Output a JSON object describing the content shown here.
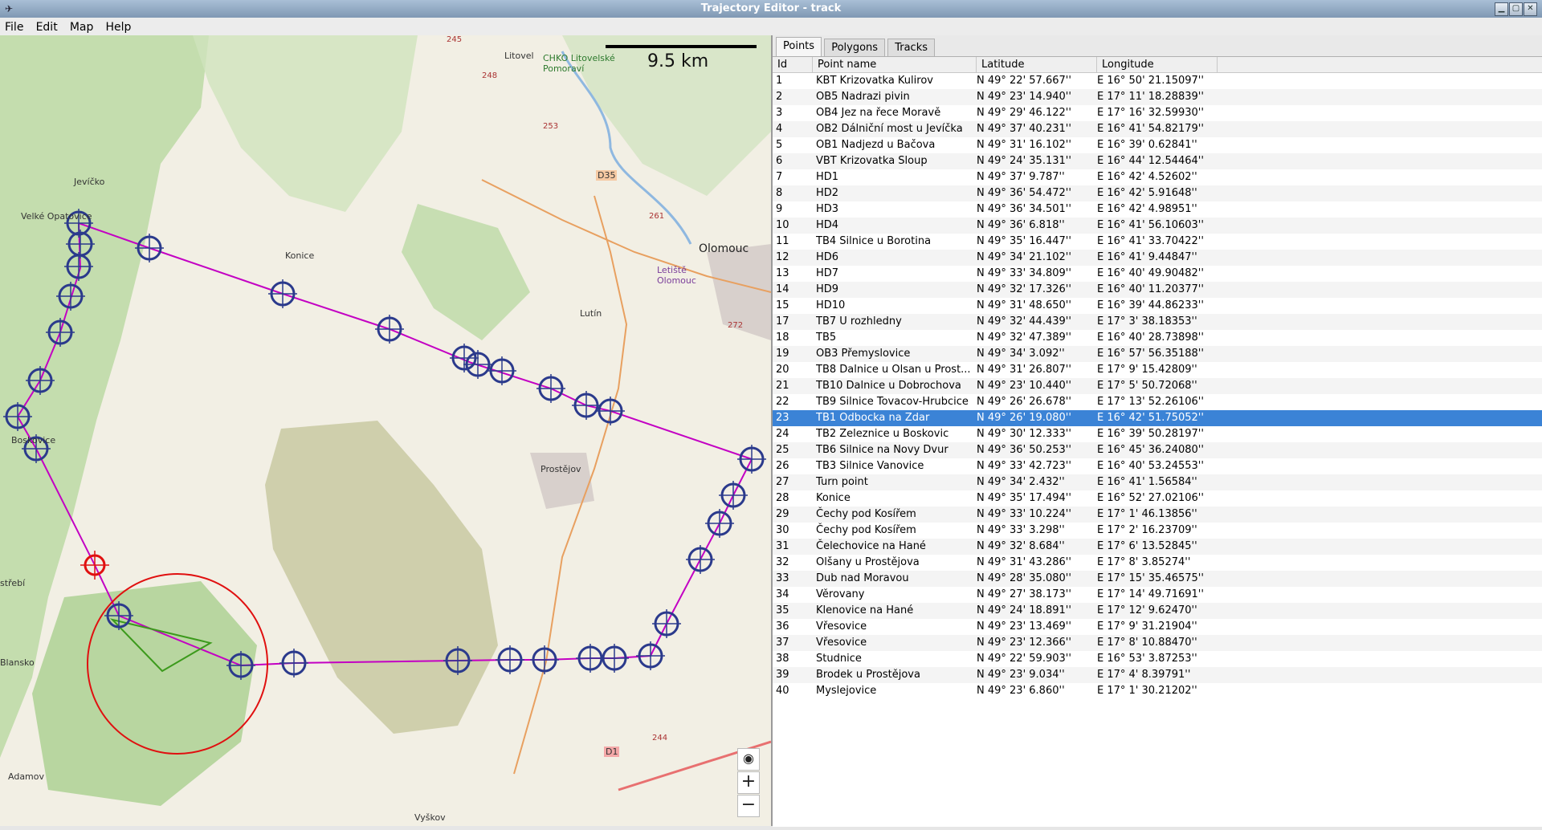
{
  "window": {
    "title": "Trajectory Editor - track"
  },
  "menu": [
    "File",
    "Edit",
    "Map",
    "Help"
  ],
  "map": {
    "scale_label": "9.5 km",
    "labels": {
      "jevicko": "Jevíčko",
      "velke_opatovice": "Velké Opatovice",
      "konice": "Konice",
      "litovel": "Litovel",
      "chko": "CHKO Litovelské Pomoraví",
      "olomouc": "Olomouc",
      "letiste": "Letiště Olomouc",
      "lutin": "Lutín",
      "boskovice": "Boskovice",
      "prostejov": "Prostějov",
      "blansko": "Blansko",
      "adamov": "Adamov",
      "vyskov": "Vyškov",
      "strebi": "střebí",
      "road_d35": "D35",
      "road_d1": "D1",
      "road_245": "245",
      "road_248": "248",
      "road_253": "253",
      "road_261": "261",
      "road_272": "272",
      "road_244": "244"
    },
    "controls": {
      "locate": "◉",
      "zoom_in": "+",
      "zoom_out": "−"
    }
  },
  "tabs": [
    "Points",
    "Polygons",
    "Tracks"
  ],
  "active_tab": "Points",
  "columns": [
    "Id",
    "Point name",
    "Latitude",
    "Longitude"
  ],
  "rows": [
    {
      "id": "1",
      "name": "KBT Krizovatka Kulirov",
      "lat": "N 49° 22' 57.667''",
      "lon": "E 16° 50' 21.15097''"
    },
    {
      "id": "2",
      "name": "OB5 Nadrazi pivin",
      "lat": "N 49° 23' 14.940''",
      "lon": "E 17° 11' 18.28839''"
    },
    {
      "id": "3",
      "name": "OB4 Jez na řece Moravě",
      "lat": "N 49° 29' 46.122''",
      "lon": "E 17° 16' 32.59930''"
    },
    {
      "id": "4",
      "name": "OB2 Dálniční most u Jevíčka",
      "lat": "N 49° 37' 40.231''",
      "lon": "E 16° 41' 54.82179''"
    },
    {
      "id": "5",
      "name": "OB1 Nadjezd u Bačova",
      "lat": "N 49° 31' 16.102''",
      "lon": "E 16° 39' 0.62841''"
    },
    {
      "id": "6",
      "name": "VBT Krizovatka Sloup",
      "lat": "N 49° 24' 35.131''",
      "lon": "E 16° 44' 12.54464''"
    },
    {
      "id": "7",
      "name": "HD1",
      "lat": "N 49° 37' 9.787''",
      "lon": "E 16° 42' 4.52602''"
    },
    {
      "id": "8",
      "name": "HD2",
      "lat": "N 49° 36' 54.472''",
      "lon": "E 16° 42' 5.91648''"
    },
    {
      "id": "9",
      "name": "HD3",
      "lat": "N 49° 36' 34.501''",
      "lon": "E 16° 42' 4.98951''"
    },
    {
      "id": "10",
      "name": "HD4",
      "lat": "N 49° 36' 6.818''",
      "lon": "E 16° 41' 56.10603''"
    },
    {
      "id": "11",
      "name": "TB4 Silnice u Borotina",
      "lat": "N 49° 35' 16.447''",
      "lon": "E 16° 41' 33.70422''"
    },
    {
      "id": "12",
      "name": "HD6",
      "lat": "N 49° 34' 21.102''",
      "lon": "E 16° 41' 9.44847''"
    },
    {
      "id": "13",
      "name": "HD7",
      "lat": "N 49° 33' 34.809''",
      "lon": "E 16° 40' 49.90482''"
    },
    {
      "id": "14",
      "name": "HD9",
      "lat": "N 49° 32' 17.326''",
      "lon": "E 16° 40' 11.20377''"
    },
    {
      "id": "15",
      "name": "HD10",
      "lat": "N 49° 31' 48.650''",
      "lon": "E 16° 39' 44.86233''"
    },
    {
      "id": "17",
      "name": "TB7 U rozhledny",
      "lat": "N 49° 32' 44.439''",
      "lon": "E 17° 3' 38.18353''"
    },
    {
      "id": "18",
      "name": "TB5",
      "lat": "N 49° 32' 47.389''",
      "lon": "E 16° 40' 28.73898''"
    },
    {
      "id": "19",
      "name": "OB3 Přemyslovice",
      "lat": "N 49° 34' 3.092''",
      "lon": "E 16° 57' 56.35188''"
    },
    {
      "id": "20",
      "name": "TB8 Dalnice u Olsan u Prost...",
      "lat": "N 49° 31' 26.807''",
      "lon": "E 17° 9' 15.42809''"
    },
    {
      "id": "21",
      "name": "TB10 Dalnice u Dobrochova",
      "lat": "N 49° 23' 10.440''",
      "lon": "E 17° 5' 50.72068''"
    },
    {
      "id": "22",
      "name": "TB9 Silnice Tovacov-Hrubcice",
      "lat": "N 49° 26' 26.678''",
      "lon": "E 17° 13' 52.26106''"
    },
    {
      "id": "23",
      "name": "TB1 Odbocka na Zdar",
      "lat": "N 49° 26' 19.080''",
      "lon": "E 16° 42' 51.75052''"
    },
    {
      "id": "24",
      "name": "TB2 Zeleznice u Boskovic",
      "lat": "N 49° 30' 12.333''",
      "lon": "E 16° 39' 50.28197''"
    },
    {
      "id": "25",
      "name": "TB6 Silnice na Novy Dvur",
      "lat": "N 49° 36' 50.253''",
      "lon": "E 16° 45' 36.24080''"
    },
    {
      "id": "26",
      "name": "TB3 Silnice Vanovice",
      "lat": "N 49° 33' 42.723''",
      "lon": "E 16° 40' 53.24553''"
    },
    {
      "id": "27",
      "name": "Turn point",
      "lat": "N 49° 34' 2.432''",
      "lon": "E 16° 41' 1.56584''"
    },
    {
      "id": "28",
      "name": "Konice",
      "lat": "N 49° 35' 17.494''",
      "lon": "E 16° 52' 27.02106''"
    },
    {
      "id": "29",
      "name": "Čechy pod Kosířem",
      "lat": "N 49° 33' 10.224''",
      "lon": "E 17° 1' 46.13856''"
    },
    {
      "id": "30",
      "name": "Čechy pod Kosířem",
      "lat": "N 49° 33' 3.298''",
      "lon": "E 17° 2' 16.23709''"
    },
    {
      "id": "31",
      "name": "Čelechovice na Hané",
      "lat": "N 49° 32' 8.684''",
      "lon": "E 17° 6' 13.52845''"
    },
    {
      "id": "32",
      "name": "Olšany u Prostějova",
      "lat": "N 49° 31' 43.286''",
      "lon": "E 17° 8' 3.85274''"
    },
    {
      "id": "33",
      "name": "Dub nad Moravou",
      "lat": "N 49° 28' 35.080''",
      "lon": "E 17° 15' 35.46575''"
    },
    {
      "id": "34",
      "name": "Věrovany",
      "lat": "N 49° 27' 38.173''",
      "lon": "E 17° 14' 49.71691''"
    },
    {
      "id": "35",
      "name": "Klenovice na Hané",
      "lat": "N 49° 24' 18.891''",
      "lon": "E 17° 12' 9.62470''"
    },
    {
      "id": "36",
      "name": "Vřesovice",
      "lat": "N 49° 23' 13.469''",
      "lon": "E 17° 9' 31.21904''"
    },
    {
      "id": "37",
      "name": "Vřesovice",
      "lat": "N 49° 23' 12.366''",
      "lon": "E 17° 8' 10.88470''"
    },
    {
      "id": "38",
      "name": "Studnice",
      "lat": "N 49° 22' 59.903''",
      "lon": "E 16° 53' 3.87253''"
    },
    {
      "id": "39",
      "name": "Brodek u Prostějova",
      "lat": "N 49° 23' 9.034''",
      "lon": "E 17° 4' 8.39791''"
    },
    {
      "id": "40",
      "name": "Myslejovice",
      "lat": "N 49° 23' 6.860''",
      "lon": "E 17° 1' 30.21202''"
    }
  ],
  "selected_id": "23",
  "colors": {
    "selection": "#3b83d6",
    "track": "#c300c3",
    "waypoint": "#2b3a8c",
    "active_point": "#e01010",
    "polygon": "#3c9a1c"
  }
}
